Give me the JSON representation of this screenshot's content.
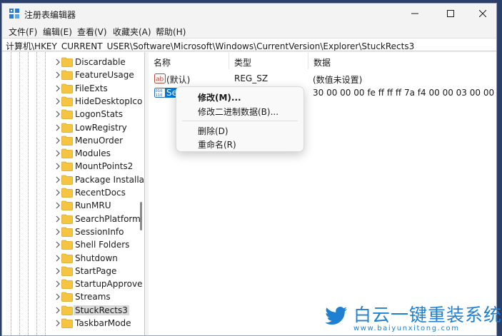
{
  "window": {
    "title": "注册表编辑器",
    "controls": {
      "minimize": "minimize",
      "maximize": "maximize",
      "close": "close"
    }
  },
  "menu": [
    "文件(F)",
    "编辑(E)",
    "查看(V)",
    "收藏夹(A)",
    "帮助(H)"
  ],
  "address": "计算机\\HKEY_CURRENT_USER\\Software\\Microsoft\\Windows\\CurrentVersion\\Explorer\\StuckRects3",
  "tree": {
    "items": [
      {
        "label": "Discardable"
      },
      {
        "label": "FeatureUsage"
      },
      {
        "label": "FileExts"
      },
      {
        "label": "HideDesktopIco"
      },
      {
        "label": "LogonStats"
      },
      {
        "label": "LowRegistry"
      },
      {
        "label": "MenuOrder"
      },
      {
        "label": "Modules"
      },
      {
        "label": "MountPoints2"
      },
      {
        "label": "Package Installa"
      },
      {
        "label": "RecentDocs"
      },
      {
        "label": "RunMRU"
      },
      {
        "label": "SearchPlatform"
      },
      {
        "label": "SessionInfo"
      },
      {
        "label": "Shell Folders"
      },
      {
        "label": "Shutdown"
      },
      {
        "label": "StartPage"
      },
      {
        "label": "StartupApprove"
      },
      {
        "label": "Streams"
      },
      {
        "label": "StuckRects3"
      },
      {
        "label": "TaskbarMode"
      }
    ],
    "selected": "StuckRects3"
  },
  "list": {
    "columns": [
      "名称",
      "类型",
      "数据"
    ],
    "rows": [
      {
        "name": "(默认)",
        "type": "REG_SZ",
        "data": "(数值未设置)",
        "icon": "string-value-icon"
      },
      {
        "name": "Settings",
        "type": "REG_BINARY",
        "data": "30 00 00 00 fe ff ff ff 7a f4 00 00 03 00 00 00 ...",
        "icon": "binary-value-icon"
      }
    ]
  },
  "context_menu": {
    "items": [
      "修改(M)...",
      "修改二进制数据(B)...",
      "删除(D)",
      "重命名(R)"
    ]
  },
  "watermark": {
    "title": "白云一键重装系统",
    "url": "www.baiyunxitong.com",
    "icon": "twitter-bird-icon"
  },
  "colors": {
    "selection": "#0078d7",
    "folder": "#f5c542",
    "watermark": "#1f7fd1"
  }
}
